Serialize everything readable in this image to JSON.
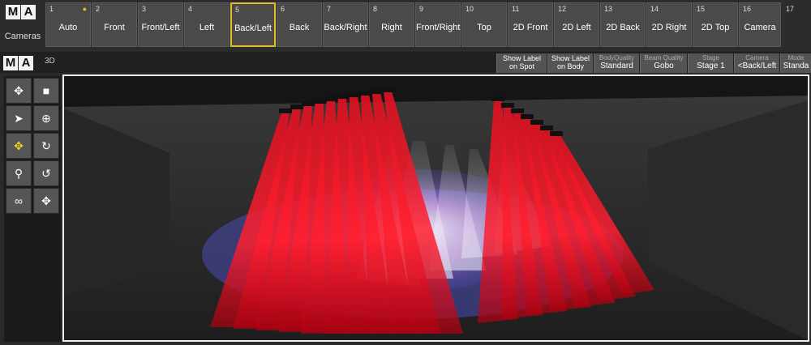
{
  "camera_bar": {
    "title": "Cameras",
    "logo": [
      "M",
      "A"
    ],
    "buttons": [
      {
        "num": "1",
        "label": "Auto",
        "locked": true
      },
      {
        "num": "2",
        "label": "Front"
      },
      {
        "num": "3",
        "label": "Front/Left"
      },
      {
        "num": "4",
        "label": "Left"
      },
      {
        "num": "5",
        "label": "Back/Left",
        "selected": true
      },
      {
        "num": "6",
        "label": "Back"
      },
      {
        "num": "7",
        "label": "Back/Right"
      },
      {
        "num": "8",
        "label": "Right"
      },
      {
        "num": "9",
        "label": "Front/Right"
      },
      {
        "num": "10",
        "label": "Top"
      },
      {
        "num": "11",
        "label": "2D Front"
      },
      {
        "num": "12",
        "label": "2D Left"
      },
      {
        "num": "13",
        "label": "2D Back"
      },
      {
        "num": "14",
        "label": "2D Right"
      },
      {
        "num": "15",
        "label": "2D Top"
      },
      {
        "num": "16",
        "label": "Camera"
      },
      {
        "num": "17",
        "label": ""
      }
    ]
  },
  "window": {
    "title": "3D",
    "logo": [
      "M",
      "A"
    ],
    "options": [
      {
        "line1": "Show Label",
        "line2": "on Spot"
      },
      {
        "line1": "Show Label",
        "line2": "on Body"
      },
      {
        "line1": "BodyQuality",
        "line2": "Standard"
      },
      {
        "line1": "Beam Quality",
        "line2": "Gobo"
      },
      {
        "line1": "Stage",
        "line2": "Stage 1"
      },
      {
        "line1": "Camera",
        "line2": "<Back/Left"
      },
      {
        "line1": "Mode",
        "line2": "Standa"
      }
    ]
  },
  "tools": [
    {
      "icon": "move-arrows-icon"
    },
    {
      "icon": "video-camera-icon"
    },
    {
      "icon": "pointer-arrow-icon"
    },
    {
      "icon": "crosshair-icon"
    },
    {
      "icon": "pan-arrows-icon",
      "active": true
    },
    {
      "icon": "rotate-icon"
    },
    {
      "icon": "zoom-icon"
    },
    {
      "icon": "orbit-icon"
    },
    {
      "icon": "link-icon"
    },
    {
      "icon": "move-small-icon"
    }
  ],
  "colors": {
    "accent_selected": "#e0c020",
    "beam_red": "#e01020",
    "beam_white": "#f0f0ff",
    "floor_blue": "#5050c0"
  }
}
